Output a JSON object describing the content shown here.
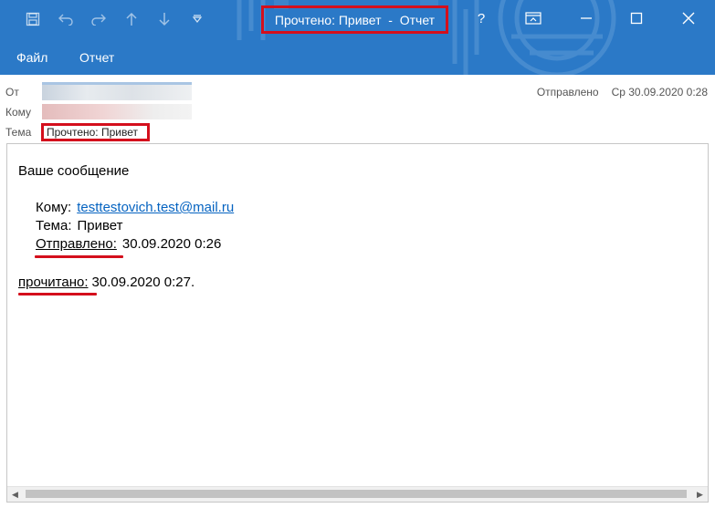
{
  "window": {
    "title": "Прочтено: Привет  -  Отчет",
    "help_glyph": "?",
    "accent_color": "#2b79c7",
    "highlight_color": "#d40f1c"
  },
  "quick_access": [
    {
      "icon": "save-icon"
    },
    {
      "icon": "undo-icon"
    },
    {
      "icon": "redo-icon"
    },
    {
      "icon": "up-arrow-icon"
    },
    {
      "icon": "down-arrow-icon"
    },
    {
      "icon": "customize-dropdown-icon"
    }
  ],
  "menu": {
    "file_label": "Файл",
    "report_label": "Отчет"
  },
  "header": {
    "from_label": "От",
    "to_label": "Кому",
    "subject_label": "Тема",
    "subject_value": "Прочтено: Привет",
    "sent_label": "Отправлено",
    "sent_value": "Ср 30.09.2020 0:28"
  },
  "message": {
    "intro": "Ваше сообщение",
    "to_label": "Кому:",
    "to_email": "testtestovich.test@mail.ru",
    "subject_label": "Тема:",
    "subject_value": "Привет",
    "sent_label": "Отправлено:",
    "sent_value": "30.09.2020 0:26",
    "read_label": "прочитано:",
    "read_value": "30.09.2020 0:27."
  }
}
